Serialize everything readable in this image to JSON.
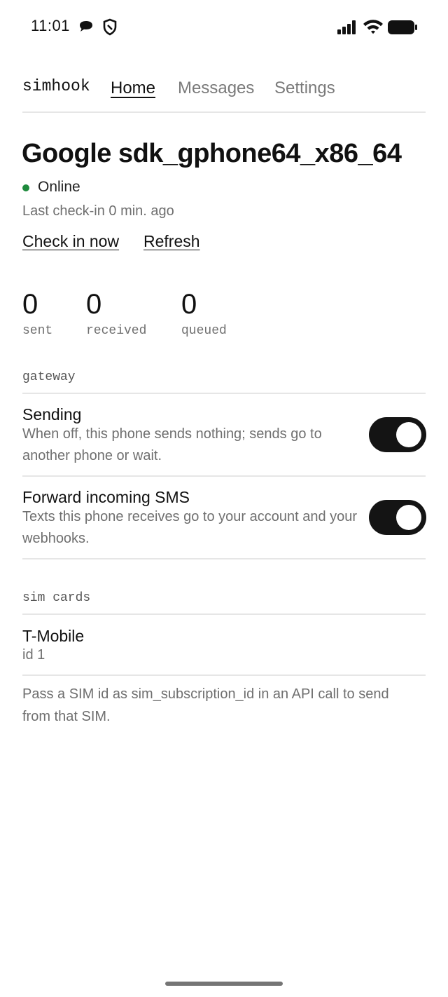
{
  "status_bar": {
    "time": "11:01",
    "icons": [
      "message-icon",
      "shield-icon",
      "signal-icon",
      "wifi-icon",
      "battery-icon"
    ]
  },
  "header": {
    "brand": "simhook",
    "tabs": [
      {
        "label": "Home",
        "active": true
      },
      {
        "label": "Messages",
        "active": false
      },
      {
        "label": "Settings",
        "active": false
      }
    ]
  },
  "device": {
    "name": "Google sdk_gphone64_x86_64",
    "status": "Online",
    "status_color": "#1e8a3c",
    "last_checkin": "Last check-in 0 min. ago",
    "actions": {
      "check_in": "Check in now",
      "refresh": "Refresh"
    }
  },
  "stats": [
    {
      "value": "0",
      "label": "sent"
    },
    {
      "value": "0",
      "label": "received"
    },
    {
      "value": "0",
      "label": "queued"
    }
  ],
  "gateway": {
    "section_label": "gateway",
    "settings": [
      {
        "title": "Sending",
        "description": "When off, this phone sends nothing; sends go to another phone or wait.",
        "enabled": true
      },
      {
        "title": "Forward incoming SMS",
        "description": "Texts this phone receives go to your account and your webhooks.",
        "enabled": true
      }
    ]
  },
  "sim_cards": {
    "section_label": "sim cards",
    "cards": [
      {
        "name": "T-Mobile",
        "id": "id 1"
      }
    ],
    "footnote": "Pass a SIM id as sim_subscription_id in an API call to send from that SIM."
  },
  "colors": {
    "toggle_on": "#141414",
    "text_primary": "#111111",
    "text_secondary": "#6f6f6f"
  }
}
